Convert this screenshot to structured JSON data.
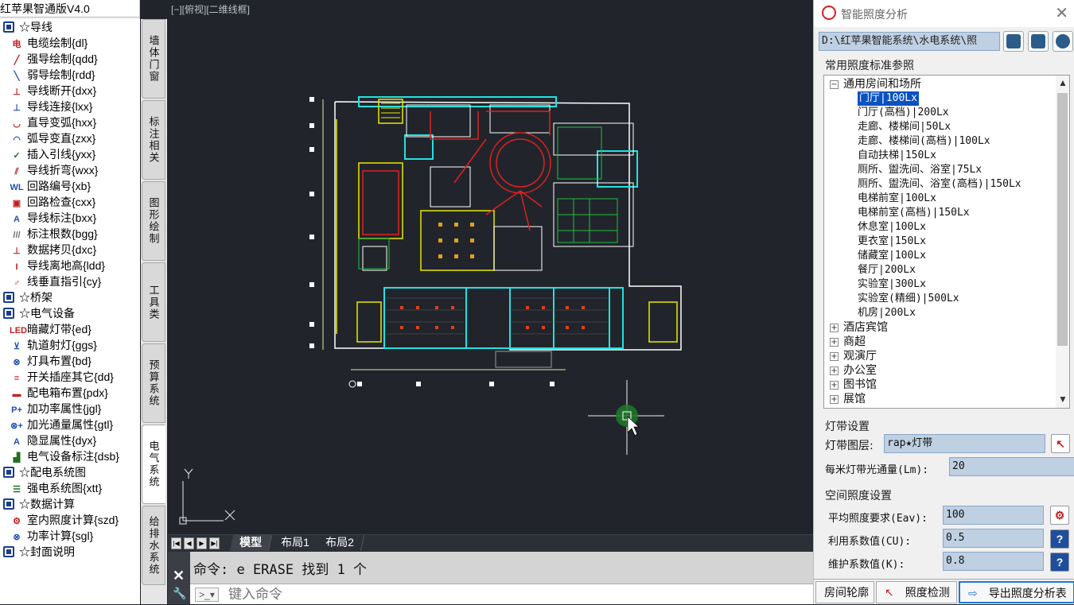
{
  "palette": {
    "title": "红苹果智通版V4.0",
    "rows": [
      {
        "kind": "cat",
        "label": "☆导线"
      },
      {
        "kind": "item",
        "icon": "电",
        "color": "#c02020",
        "label": "电缆绘制{dl}"
      },
      {
        "kind": "item",
        "icon": "╱",
        "color": "#c02020",
        "label": "强导绘制{qdd}"
      },
      {
        "kind": "item",
        "icon": "╲",
        "color": "#1f4fb0",
        "label": "弱导绘制{rdd}"
      },
      {
        "kind": "item",
        "icon": "⊥",
        "color": "#c02020",
        "label": "导线断开{dxx}"
      },
      {
        "kind": "item",
        "icon": "⊥",
        "color": "#1f4fb0",
        "label": "导线连接{lxx}"
      },
      {
        "kind": "item",
        "icon": "◡",
        "color": "#c02020",
        "label": "直导变弧{hxx}"
      },
      {
        "kind": "item",
        "icon": "◠",
        "color": "#1f4fb0",
        "label": "弧导变直{zxx}"
      },
      {
        "kind": "item",
        "icon": "✓",
        "color": "#207020",
        "label": "插入引线{yxx}"
      },
      {
        "kind": "item",
        "icon": "⫽",
        "color": "#c02020",
        "label": "导线折弯{wxx}"
      },
      {
        "kind": "item",
        "icon": "WL",
        "color": "#1f4fb0",
        "label": "回路编号{xb}"
      },
      {
        "kind": "item",
        "icon": "▣",
        "color": "#c02020",
        "label": "回路检查{cxx}"
      },
      {
        "kind": "item",
        "icon": "A",
        "color": "#1f4fb0",
        "label": "导线标注{bxx}"
      },
      {
        "kind": "item",
        "icon": "///",
        "color": "#666666",
        "label": "标注根数{bgg}"
      },
      {
        "kind": "item",
        "icon": "⊥",
        "color": "#c02020",
        "label": "数据拷贝{dxc}"
      },
      {
        "kind": "item",
        "icon": "I",
        "color": "#c02020",
        "label": "导线离地高{ldd}"
      },
      {
        "kind": "item",
        "icon": "♂",
        "color": "#c02020",
        "label": "线垂直指引{cy}"
      },
      {
        "kind": "cat",
        "label": "☆桥架"
      },
      {
        "kind": "cat",
        "label": "☆电气设备"
      },
      {
        "kind": "item",
        "icon": "LED",
        "color": "#c02020",
        "label": "暗藏灯带{ed}"
      },
      {
        "kind": "item",
        "icon": "⊻",
        "color": "#1f4fb0",
        "label": "轨道射灯{ggs}"
      },
      {
        "kind": "item",
        "icon": "⊗",
        "color": "#1f4fb0",
        "label": "灯具布置{bd}"
      },
      {
        "kind": "item",
        "icon": "≡",
        "color": "#c02020",
        "label": "开关插座其它{dd}"
      },
      {
        "kind": "item",
        "icon": "▬",
        "color": "#c02020",
        "label": "配电箱布置{pdx}"
      },
      {
        "kind": "item",
        "icon": "P+",
        "color": "#1f4fb0",
        "label": "加功率属性{jgl}"
      },
      {
        "kind": "item",
        "icon": "⊗+",
        "color": "#1f4fb0",
        "label": "加光通量属性{gtl}"
      },
      {
        "kind": "item",
        "icon": "A",
        "color": "#1f4fb0",
        "label": "隐显属性{dyx}"
      },
      {
        "kind": "item",
        "icon": "▟",
        "color": "#207020",
        "label": "电气设备标注{dsb}"
      },
      {
        "kind": "cat",
        "label": "☆配电系统图"
      },
      {
        "kind": "item",
        "icon": "☰",
        "color": "#207020",
        "label": "强电系统图{xtt}"
      },
      {
        "kind": "cat",
        "label": "☆数据计算"
      },
      {
        "kind": "item",
        "icon": "⚙",
        "color": "#c02020",
        "label": "室内照度计算{szd}"
      },
      {
        "kind": "item",
        "icon": "⊗",
        "color": "#1f4fb0",
        "label": "功率计算{sgl}"
      },
      {
        "kind": "cat",
        "label": "☆封面说明"
      }
    ]
  },
  "vtabs": [
    "墙体门窗",
    "标注相关",
    "图形绘制",
    "工具类",
    "预算系统",
    "电气系统",
    "给排水系统"
  ],
  "viewport": {
    "label": "[−][俯视][二维线框]"
  },
  "model_tabs": [
    "模型",
    "布局1",
    "布局2"
  ],
  "command": {
    "history": "命令: e ERASE 找到 1 个",
    "placeholder": "键入命令"
  },
  "panel": {
    "title": "智能照度分析",
    "path": "D:\\红苹果智能系统\\水电系统\\照",
    "standards_label": "常用照度标准参照",
    "tree": [
      {
        "label": "通用房间和场所",
        "level": 0,
        "expanded": true
      },
      {
        "label": "门厅|100Lx",
        "level": 1,
        "selected": true
      },
      {
        "label": "门厅(高档)|200Lx",
        "level": 1
      },
      {
        "label": "走廊、楼梯间|50Lx",
        "level": 1
      },
      {
        "label": "走廊、楼梯间(高档)|100Lx",
        "level": 1
      },
      {
        "label": "自动扶梯|150Lx",
        "level": 1
      },
      {
        "label": "厕所、盥洗间、浴室|75Lx",
        "level": 1
      },
      {
        "label": "厕所、盥洗间、浴室(高档)|150Lx",
        "level": 1
      },
      {
        "label": "电梯前室|100Lx",
        "level": 1
      },
      {
        "label": "电梯前室(高档)|150Lx",
        "level": 1
      },
      {
        "label": "休息室|100Lx",
        "level": 1
      },
      {
        "label": "更衣室|150Lx",
        "level": 1
      },
      {
        "label": "储藏室|100Lx",
        "level": 1
      },
      {
        "label": "餐厅|200Lx",
        "level": 1
      },
      {
        "label": "实验室|300Lx",
        "level": 1
      },
      {
        "label": "实验室(精细)|500Lx",
        "level": 1
      },
      {
        "label": "机房|200Lx",
        "level": 1
      },
      {
        "label": "酒店宾馆",
        "level": 0
      },
      {
        "label": "商超",
        "level": 0
      },
      {
        "label": "观演厅",
        "level": 0
      },
      {
        "label": "办公室",
        "level": 0
      },
      {
        "label": "图书馆",
        "level": 0
      },
      {
        "label": "展馆",
        "level": 0
      }
    ],
    "strip": {
      "group_label": "灯带设置",
      "layer_label": "灯带图层:",
      "layer_value": "rap★灯带",
      "flux_label": "每米灯带光通量(Lm):",
      "flux_value": "20"
    },
    "space": {
      "group_label": "空间照度设置",
      "eav_label": "平均照度要求(Eav):",
      "eav_value": "100",
      "cu_label": "利用系数值(CU):",
      "cu_value": "0.5",
      "k_label": "维护系数值(K):",
      "k_value": "0.8"
    },
    "bottom": {
      "room_outline": "房间轮廓",
      "check": "照度检测",
      "export": "导出照度分析表"
    }
  },
  "colors": {
    "accent": "#1e7ad6",
    "canvas_bg": "#21252b",
    "selected": "#0a52c4"
  }
}
